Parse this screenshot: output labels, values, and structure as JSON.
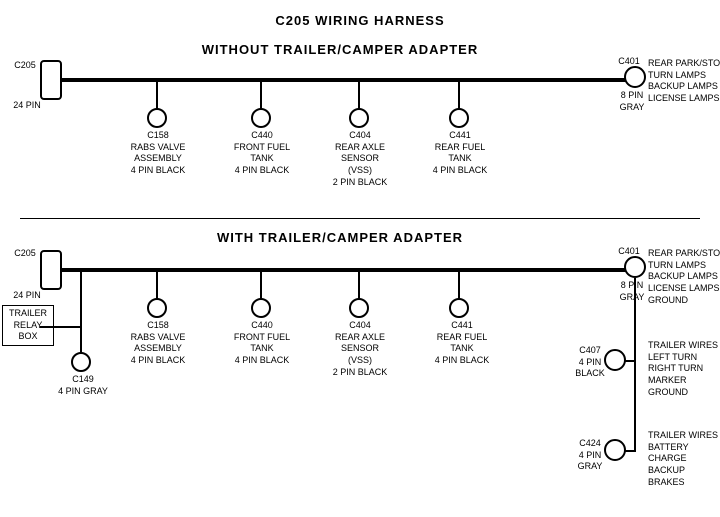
{
  "title": "C205 WIRING HARNESS",
  "section1": {
    "label": "WITHOUT  TRAILER/CAMPER  ADAPTER",
    "connectors": [
      {
        "id": "C205-1",
        "label": "C205\n24 PIN",
        "side": "left"
      },
      {
        "id": "C401-1",
        "label": "C401\n8 PIN\nGRAY",
        "side": "right"
      },
      {
        "id": "C158-1",
        "label": "C158\nRABS VALVE\nASSEMBLY\n4 PIN BLACK"
      },
      {
        "id": "C440-1",
        "label": "C440\nFRONT FUEL\nTANK\n4 PIN BLACK"
      },
      {
        "id": "C404-1",
        "label": "C404\nREAR AXLE\nSENSOR\n(VSS)\n2 PIN BLACK"
      },
      {
        "id": "C441-1",
        "label": "C441\nREAR FUEL\nTANK\n4 PIN BLACK"
      }
    ],
    "rightLabel": "REAR PARK/STOP\nTURN LAMPS\nBACKUP LAMPS\nLICENSE LAMPS"
  },
  "section2": {
    "label": "WITH  TRAILER/CAMPER  ADAPTER",
    "connectors": [
      {
        "id": "C205-2",
        "label": "C205\n24 PIN",
        "side": "left"
      },
      {
        "id": "C401-2",
        "label": "C401\n8 PIN\nGRAY",
        "side": "right"
      },
      {
        "id": "C158-2",
        "label": "C158\nRABS VALVE\nASSEMBLY\n4 PIN BLACK"
      },
      {
        "id": "C440-2",
        "label": "C440\nFRONT FUEL\nTANK\n4 PIN BLACK"
      },
      {
        "id": "C404-2",
        "label": "C404\nREAR AXLE\nSENSOR\n(VSS)\n2 PIN BLACK"
      },
      {
        "id": "C441-2",
        "label": "C441\nREAR FUEL\nTANK\n4 PIN BLACK"
      },
      {
        "id": "C149",
        "label": "C149\n4 PIN GRAY"
      },
      {
        "id": "C407",
        "label": "C407\n4 PIN\nBLACK"
      },
      {
        "id": "C424",
        "label": "C424\n4 PIN\nGRAY"
      }
    ],
    "trailerRelayBox": "TRAILER\nRELAY\nBOX",
    "rightLabel1": "REAR PARK/STOP\nTURN LAMPS\nBACKUP LAMPS\nLICENSE LAMPS\nGROUND",
    "rightLabel2": "TRAILER WIRES\nLEFT TURN\nRIGHT TURN\nMARKER\nGROUND",
    "rightLabel3": "TRAILER WIRES\nBATTERY CHARGE\nBACKUP\nBRAKES"
  }
}
